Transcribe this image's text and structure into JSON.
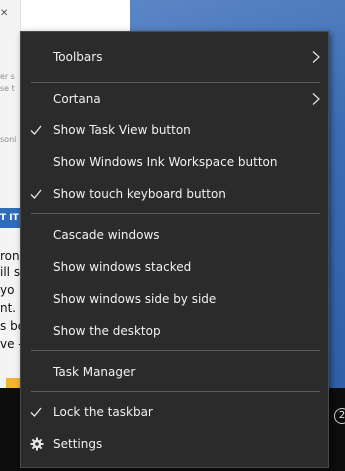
{
  "background": {
    "fragments": [
      {
        "text": "er s",
        "kind": "small"
      },
      {
        "text": "se t",
        "kind": "small"
      },
      {
        "text": "soni",
        "kind": "small"
      },
      {
        "text": "T IT",
        "kind": "bar"
      },
      {
        "text": "roni",
        "kind": "body"
      },
      {
        "text": "ill  s",
        "kind": "body"
      },
      {
        "text": " yo",
        "kind": "body"
      },
      {
        "text": "nt.",
        "kind": "body"
      },
      {
        "text": "s be",
        "kind": "body"
      },
      {
        "text": "ve -",
        "kind": "body"
      }
    ],
    "taskbar_badge": "2"
  },
  "context_menu": {
    "items": [
      {
        "label": "Toolbars",
        "checked": false,
        "submenu": true,
        "icon": "none"
      },
      {
        "label": "Cortana",
        "checked": false,
        "submenu": true,
        "icon": "none"
      },
      {
        "label": "Show Task View button",
        "checked": true,
        "submenu": false,
        "icon": "check"
      },
      {
        "label": "Show Windows Ink Workspace button",
        "checked": false,
        "submenu": false,
        "icon": "none"
      },
      {
        "label": "Show touch keyboard button",
        "checked": true,
        "submenu": false,
        "icon": "check"
      },
      {
        "label": "Cascade windows",
        "checked": false,
        "submenu": false,
        "icon": "none"
      },
      {
        "label": "Show windows stacked",
        "checked": false,
        "submenu": false,
        "icon": "none"
      },
      {
        "label": "Show windows side by side",
        "checked": false,
        "submenu": false,
        "icon": "none"
      },
      {
        "label": "Show the desktop",
        "checked": false,
        "submenu": false,
        "icon": "none"
      },
      {
        "label": "Task Manager",
        "checked": false,
        "submenu": false,
        "icon": "none"
      },
      {
        "label": "Lock the taskbar",
        "checked": true,
        "submenu": false,
        "icon": "check"
      },
      {
        "label": "Settings",
        "checked": false,
        "submenu": false,
        "icon": "gear-icon"
      }
    ]
  },
  "colors": {
    "menu_background": "#2b2b2b",
    "menu_text": "#f2f2f2",
    "separator": "#5a5a5a",
    "desktop": "#3d6db3",
    "taskbar": "#0d0d0d"
  }
}
